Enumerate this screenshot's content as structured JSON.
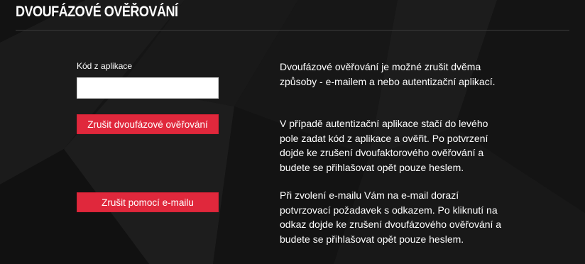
{
  "page": {
    "title": "DVOUFÁZOVÉ OVĚŘOVÁNÍ"
  },
  "form": {
    "code_label": "Kód z aplikace",
    "code_value": "",
    "disable_button": "Zrušit dvoufázové ověřování",
    "email_button": "Zrušit pomocí e-mailu"
  },
  "info": {
    "paragraphs": [
      "Dvoufázové ověřování je možné zrušit dvěma způsoby - e-mailem a nebo autentizační aplikací.",
      "V případě autentizační aplikace stačí do levého pole zadat kód z aplikace a ověřit. Po potvrzení dojde ke zrušení dvoufaktorového ověřování a budete se přihlašovat opět pouze heslem.",
      "Při zvolení e-mailu Vám na e-mail dorazí potvrzovací požadavek s odkazem. Po kliknutí na odkaz dojde ke zrušení dvoufázového ověřování a budete se přihlašovat opět pouze heslem."
    ]
  },
  "colors": {
    "background": "#161616",
    "accent": "#e0283c",
    "text": "#ffffff"
  }
}
